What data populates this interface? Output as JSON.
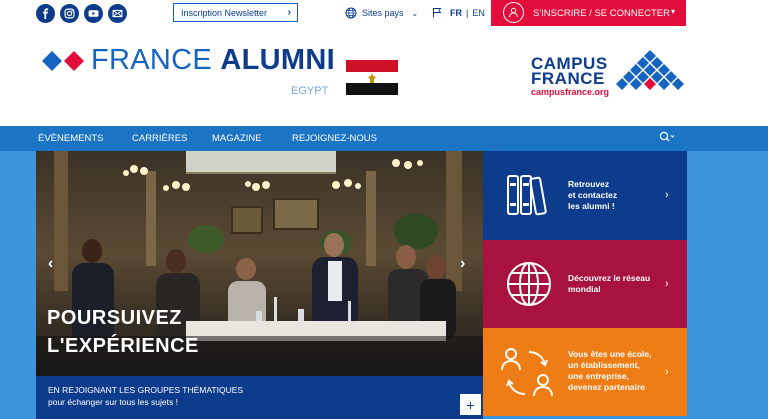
{
  "topbar": {
    "social_icons": [
      "facebook-icon",
      "instagram-icon",
      "youtube-icon",
      "email-icon"
    ],
    "newsletter_label": "Inscription Newsletter",
    "sites_label": "Sites pays",
    "lang_active": "FR",
    "lang_sep": "|",
    "lang_other": "EN",
    "signup_label": "S'INSCRIRE / SE CONNECTER"
  },
  "header": {
    "logo_part1": "FRANCE ",
    "logo_part2": "ALUMNI",
    "country": "EGYPT",
    "partner_line1": "CAMPUS",
    "partner_line2": "FRANCE",
    "partner_url": "campusfrance.org"
  },
  "nav": {
    "items": [
      "ÉVÈNEMENTS",
      "CARRIÈRES",
      "MAGAZINE",
      "REJOIGNEZ-NOUS"
    ]
  },
  "hero": {
    "title_line1": "POURSUIVEZ",
    "title_line2": "L'EXPÉRIENCE",
    "caption_line1": "EN REJOIGNANT LES GROUPES THÉMATIQUES",
    "caption_line2": "pour échanger sur tous les sujets !",
    "plus": "+"
  },
  "tiles": [
    {
      "line1": "Retrouvez",
      "line2": "et contactez",
      "line3": "les alumni !",
      "line4": "",
      "color": "#0d3c8c"
    },
    {
      "line1": "Découvrez le réseau",
      "line2": "mondial",
      "line3": "",
      "line4": "",
      "color": "#a8123e"
    },
    {
      "line1": "Vous êtes une école,",
      "line2": "un établissement,",
      "line3": "une entreprise,",
      "line4": "devenez partenaire",
      "color": "#ef7d16"
    }
  ],
  "colors": {
    "brand_blue": "#0d3c8c",
    "nav_blue": "#1c74c4",
    "red": "#e30d3b",
    "bg_blue": "#3e95db"
  }
}
